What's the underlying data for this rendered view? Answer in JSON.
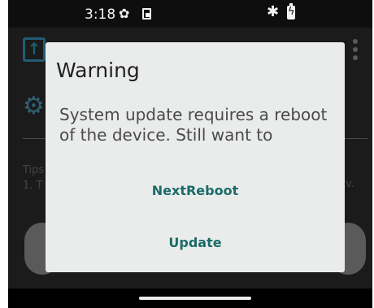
{
  "status_bar": {
    "time": "3:18"
  },
  "background": {
    "app_icon_glyph": "↑",
    "tips_line1": "Tips",
    "tips_line2": "1. T",
    "tips_tail": "tv."
  },
  "dialog": {
    "title": "Warning",
    "message": "System update requires a reboot of the device. Still want to",
    "buttons": [
      "NextReboot",
      "Update"
    ]
  },
  "colors": {
    "accent": "#1a6b68",
    "dialog_bg": "#eaeceb",
    "screen_bg": "#1b1b1b"
  }
}
